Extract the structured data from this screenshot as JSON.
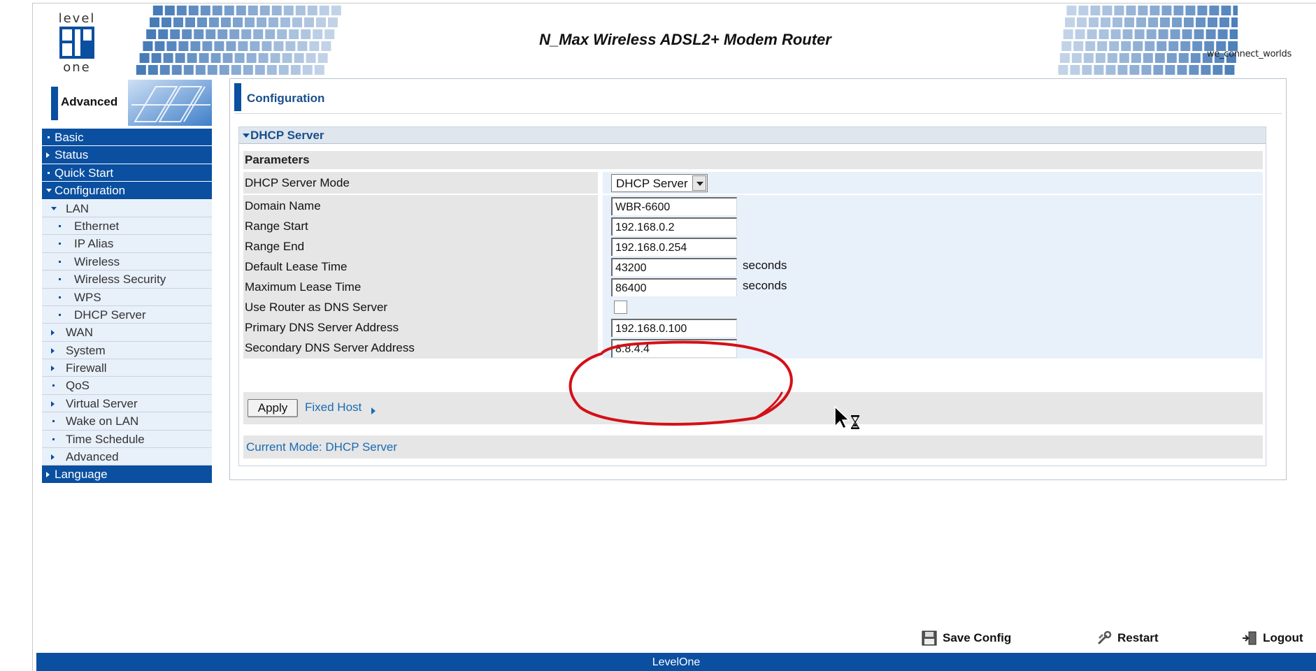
{
  "header": {
    "logo_top": "level",
    "logo_bottom": "one",
    "title": "N_Max Wireless ADSL2+ Modem Router",
    "tagline": "we_connect_worlds"
  },
  "sidebar": {
    "section_title": "Advanced",
    "items": [
      {
        "label": "Basic",
        "level": 0,
        "marker": "dot"
      },
      {
        "label": "Status",
        "level": 0,
        "marker": "arrow-right"
      },
      {
        "label": "Quick Start",
        "level": 0,
        "marker": "dot"
      },
      {
        "label": "Configuration",
        "level": 0,
        "marker": "arrow-down"
      },
      {
        "label": "LAN",
        "level": 1,
        "marker": "arrow-down"
      },
      {
        "label": "Ethernet",
        "level": 2,
        "marker": "dot"
      },
      {
        "label": "IP Alias",
        "level": 2,
        "marker": "dot"
      },
      {
        "label": "Wireless",
        "level": 2,
        "marker": "dot"
      },
      {
        "label": "Wireless Security",
        "level": 2,
        "marker": "dot"
      },
      {
        "label": "WPS",
        "level": 2,
        "marker": "dot"
      },
      {
        "label": "DHCP Server",
        "level": 2,
        "marker": "dot"
      },
      {
        "label": "WAN",
        "level": 1,
        "marker": "arrow-right"
      },
      {
        "label": "System",
        "level": 1,
        "marker": "arrow-right"
      },
      {
        "label": "Firewall",
        "level": 1,
        "marker": "arrow-right"
      },
      {
        "label": "QoS",
        "level": 1,
        "marker": "dot"
      },
      {
        "label": "Virtual Server",
        "level": 1,
        "marker": "arrow-right"
      },
      {
        "label": "Wake on LAN",
        "level": 1,
        "marker": "dot"
      },
      {
        "label": "Time Schedule",
        "level": 1,
        "marker": "dot"
      },
      {
        "label": "Advanced",
        "level": 1,
        "marker": "arrow-right"
      },
      {
        "label": "Language",
        "level": 0,
        "marker": "arrow-right"
      }
    ]
  },
  "main": {
    "page_title": "Configuration",
    "section_title": "DHCP Server",
    "params_title": "Parameters",
    "fields": {
      "mode": {
        "label": "DHCP Server Mode",
        "value": "DHCP Server"
      },
      "domain": {
        "label": "Domain Name",
        "value": "WBR-6600"
      },
      "range_start": {
        "label": "Range Start",
        "value": "192.168.0.2"
      },
      "range_end": {
        "label": "Range End",
        "value": "192.168.0.254"
      },
      "default_lease": {
        "label": "Default Lease Time",
        "value": "43200",
        "unit": "seconds"
      },
      "max_lease": {
        "label": "Maximum Lease Time",
        "value": "86400",
        "unit": "seconds"
      },
      "router_dns": {
        "label": "Use Router as DNS Server",
        "checked": false
      },
      "primary_dns": {
        "label": "Primary DNS Server Address",
        "value": "192.168.0.100"
      },
      "secondary_dns": {
        "label": "Secondary DNS Server Address",
        "value": "8.8.4.4"
      }
    },
    "apply_label": "Apply",
    "fixed_host_label": "Fixed Host",
    "current_mode": "Current Mode: DHCP Server"
  },
  "footer": {
    "save_label": "Save Config",
    "restart_label": "Restart",
    "logout_label": "Logout",
    "brand": "LevelOne"
  },
  "annotation": {
    "color": "#d41018",
    "icon": "red-circle-annotation"
  },
  "colors": {
    "brand_blue": "#0a4fa0",
    "link_blue": "#1a6bb3",
    "sub_bg": "#e8f0fa",
    "label_bg": "#e6e6e6"
  }
}
